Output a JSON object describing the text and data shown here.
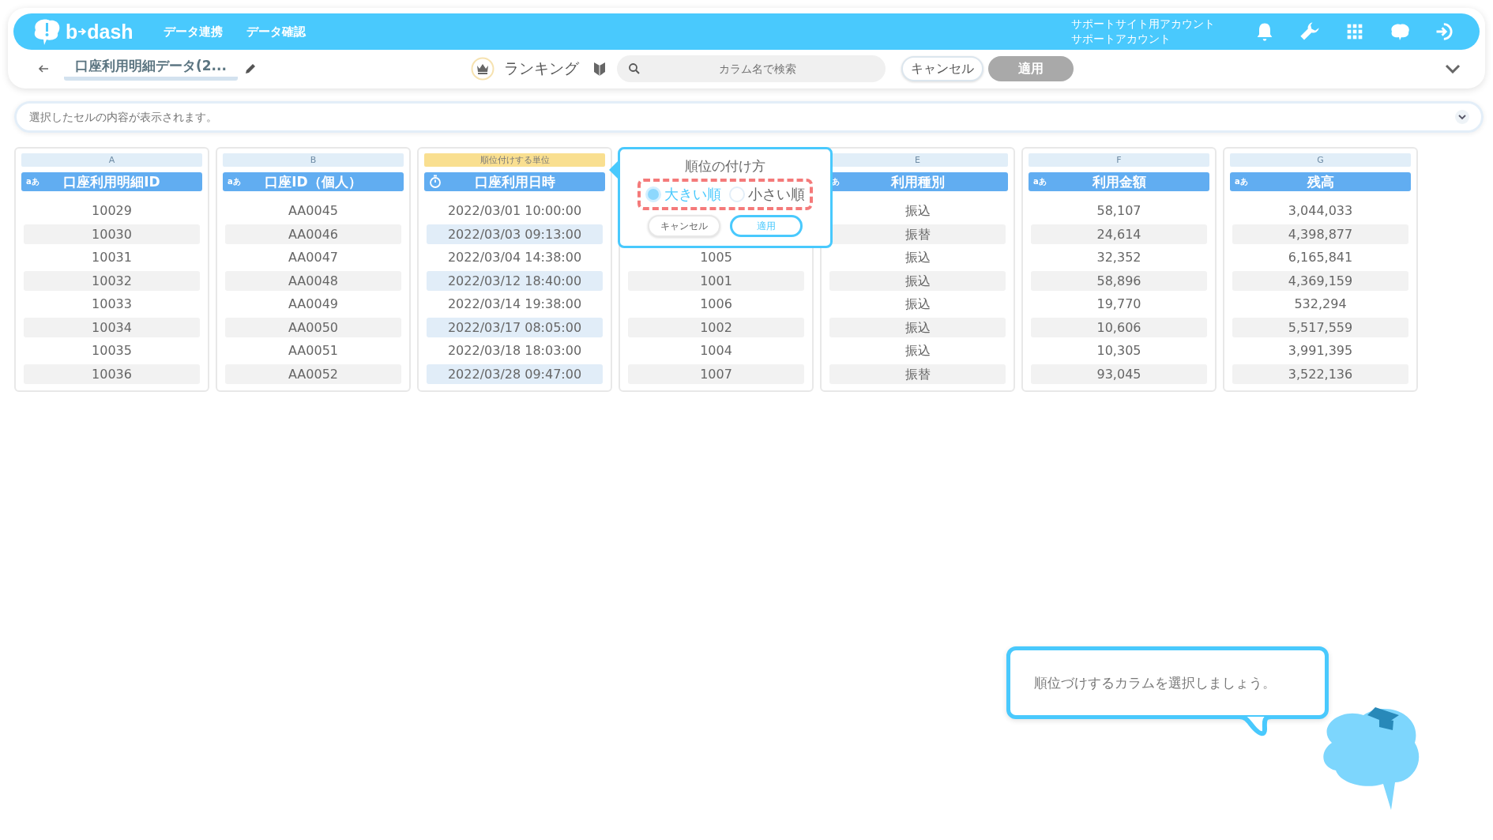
{
  "header": {
    "logo_left": "b",
    "logo_right": "dash",
    "nav": [
      "データ連携",
      "データ確認"
    ],
    "account": [
      "サポートサイト用アカウント",
      "サポートアカウント"
    ]
  },
  "toolbar": {
    "title": "口座利用明細データ(2...",
    "mode": "ランキング",
    "search": {
      "placeholder": "カラム名で検索"
    },
    "cancel": {
      "label": "キャンセル",
      "disabled": false
    },
    "apply": {
      "label": "適用",
      "disabled": true
    }
  },
  "cell_viewer": {
    "placeholder": "選択したセルの内容が表示されます。"
  },
  "columns": [
    {
      "letter": "A",
      "selected": false,
      "kind": "text",
      "type_label": "aあ",
      "title": "口座利用明細ID",
      "cells": [
        "10029",
        "10030",
        "10031",
        "10032",
        "10033",
        "10034",
        "10035",
        "10036"
      ]
    },
    {
      "letter": "B",
      "selected": false,
      "kind": "text",
      "type_label": "aあ",
      "title": "口座ID（個人）",
      "cells": [
        "AA0045",
        "AA0046",
        "AA0047",
        "AA0048",
        "AA0049",
        "AA0050",
        "AA0051",
        "AA0052"
      ]
    },
    {
      "unit_label": "順位付けする単位",
      "selected": true,
      "kind": "datetime",
      "title": "口座利用日時",
      "cells": [
        "2022/03/01 10:00:00",
        "2022/03/03 09:13:00",
        "2022/03/04 14:38:00",
        "2022/03/12 18:40:00",
        "2022/03/14 19:38:00",
        "2022/03/17 08:05:00",
        "2022/03/18 18:03:00",
        "2022/03/28 09:47:00"
      ]
    },
    {
      "selected": false,
      "kind": "covered",
      "cells": [
        "1005",
        "1001",
        "1006",
        "1002",
        "1004",
        "1007"
      ]
    },
    {
      "letter": "E",
      "selected": false,
      "kind": "text",
      "type_label": "あ",
      "title": "利用種別",
      "cells": [
        "振込",
        "振替",
        "振込",
        "振込",
        "振込",
        "振込",
        "振込",
        "振替"
      ]
    },
    {
      "letter": "F",
      "selected": false,
      "kind": "text",
      "type_label": "aあ",
      "title": "利用金額",
      "cells": [
        "58,107",
        "24,614",
        "32,352",
        "58,896",
        "19,770",
        "10,606",
        "10,305",
        "93,045"
      ]
    },
    {
      "letter": "G",
      "selected": false,
      "kind": "text",
      "type_label": "aあ",
      "title": "残高",
      "cells": [
        "3,044,033",
        "4,398,877",
        "6,165,841",
        "4,369,159",
        "532,294",
        "5,517,559",
        "3,991,395",
        "3,522,136"
      ]
    }
  ],
  "popup": {
    "title": "順位の付け方",
    "options": [
      {
        "label": "大きい順",
        "selected": true
      },
      {
        "label": "小さい順",
        "selected": false
      }
    ],
    "cancel": "キャンセル",
    "apply": "適用"
  },
  "guide": {
    "message": "順位づけするカラムを選択しましょう。"
  }
}
